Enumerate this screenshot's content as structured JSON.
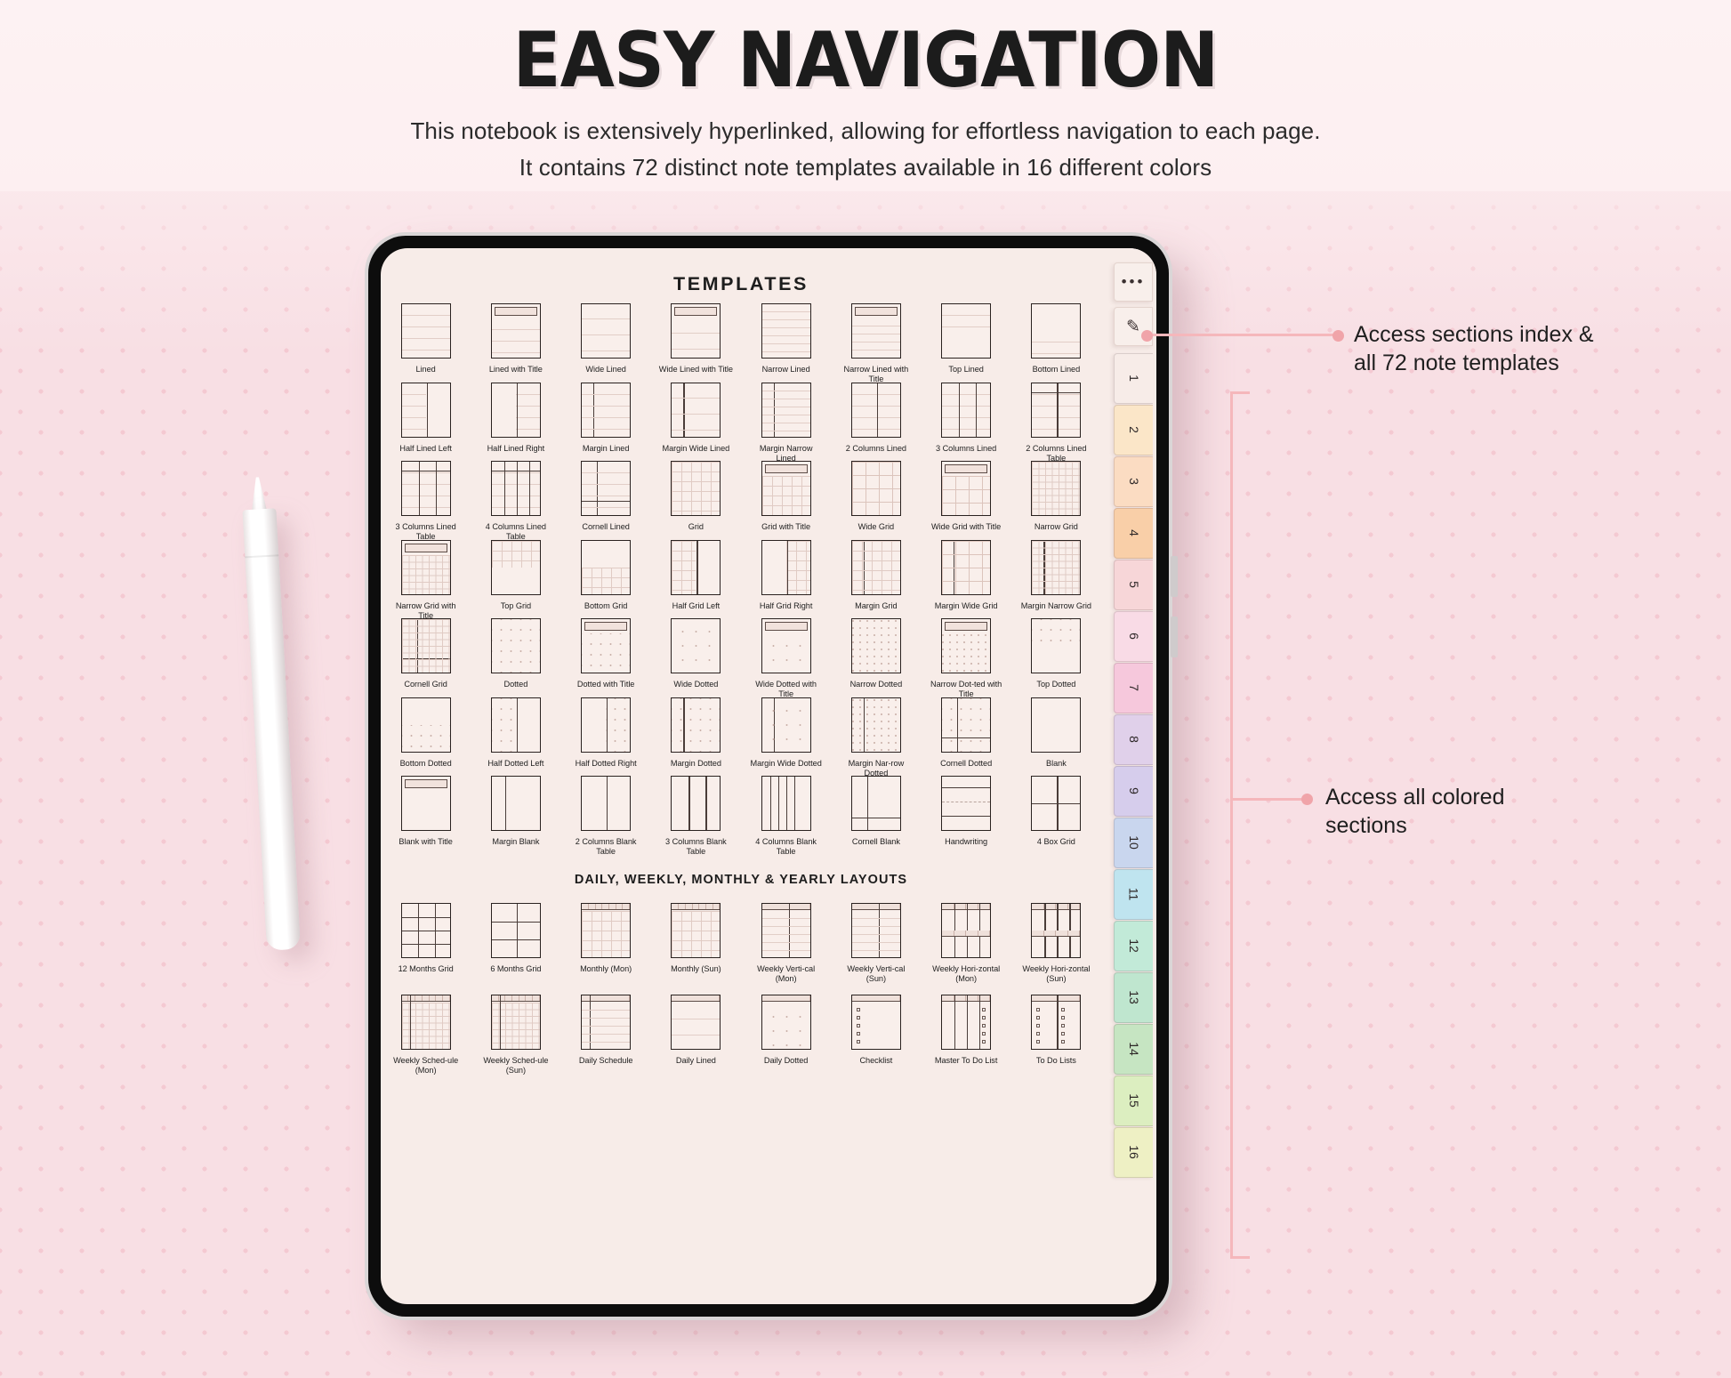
{
  "header": {
    "title": "EASY NAVIGATION",
    "subtitle_line1": "This notebook is extensively hyperlinked, allowing for effortless navigation to each page.",
    "subtitle_line2": "It contains 72 distinct note templates available in 16 different colors"
  },
  "screen": {
    "title": "TEMPLATES",
    "section_heading": "DAILY, WEEKLY, MONTHLY & YEARLY LAYOUTS"
  },
  "rail": {
    "menu_icon": "three-dots-icon",
    "menu_glyph": "•••",
    "pen_icon": "pencil-icon",
    "pen_glyph": "✎",
    "color_tabs": [
      {
        "number": "1",
        "color": "#f7ece8"
      },
      {
        "number": "2",
        "color": "#fbe6c8"
      },
      {
        "number": "3",
        "color": "#fbdcc2"
      },
      {
        "number": "4",
        "color": "#f9cfa8"
      },
      {
        "number": "5",
        "color": "#f7d6d8"
      },
      {
        "number": "6",
        "color": "#f9dbe6"
      },
      {
        "number": "7",
        "color": "#f6c8dc"
      },
      {
        "number": "8",
        "color": "#e0d0ea"
      },
      {
        "number": "9",
        "color": "#d6cdec"
      },
      {
        "number": "10",
        "color": "#c9d6ee"
      },
      {
        "number": "11",
        "color": "#bfe4ef"
      },
      {
        "number": "12",
        "color": "#c2ead8"
      },
      {
        "number": "13",
        "color": "#bfe6cf"
      },
      {
        "number": "14",
        "color": "#c6e5c2"
      },
      {
        "number": "15",
        "color": "#dceec0"
      },
      {
        "number": "16",
        "color": "#eef0c4"
      }
    ]
  },
  "annotations": [
    {
      "id": "index-annotation",
      "line1": "Access sections index &",
      "line2": "all 72 note templates"
    },
    {
      "id": "colors-annotation",
      "line1": "Access all colored",
      "line2": "sections"
    }
  ],
  "templates": {
    "rows": [
      [
        {
          "label": "Lined",
          "kind": "lined"
        },
        {
          "label": "Lined with Title",
          "kind": "lined-title"
        },
        {
          "label": "Wide Lined",
          "kind": "wide-lined"
        },
        {
          "label": "Wide Lined with Title",
          "kind": "wide-lined-title"
        },
        {
          "label": "Narrow Lined",
          "kind": "narrow-lined"
        },
        {
          "label": "Narrow Lined with Title",
          "kind": "narrow-lined-title"
        },
        {
          "label": "Top Lined",
          "kind": "top-lined"
        },
        {
          "label": "Bottom Lined",
          "kind": "bottom-lined"
        }
      ],
      [
        {
          "label": "Half Lined Left",
          "kind": "half-lined-left"
        },
        {
          "label": "Half Lined Right",
          "kind": "half-lined-right"
        },
        {
          "label": "Margin Lined",
          "kind": "margin-lined"
        },
        {
          "label": "Margin Wide Lined",
          "kind": "margin-wide-lined"
        },
        {
          "label": "Margin Narrow Lined",
          "kind": "margin-narrow-lined"
        },
        {
          "label": "2 Columns Lined",
          "kind": "2col-lined"
        },
        {
          "label": "3 Columns Lined",
          "kind": "3col-lined"
        },
        {
          "label": "2 Columns Lined Table",
          "kind": "2col-lined-table"
        }
      ],
      [
        {
          "label": "3 Columns Lined Table",
          "kind": "3col-lined-table"
        },
        {
          "label": "4 Columns Lined Table",
          "kind": "4col-lined-table"
        },
        {
          "label": "Cornell Lined",
          "kind": "cornell-lined"
        },
        {
          "label": "Grid",
          "kind": "grid"
        },
        {
          "label": "Grid with Title",
          "kind": "grid-title"
        },
        {
          "label": "Wide Grid",
          "kind": "wide-grid"
        },
        {
          "label": "Wide Grid with Title",
          "kind": "wide-grid-title"
        },
        {
          "label": "Narrow Grid",
          "kind": "narrow-grid"
        }
      ],
      [
        {
          "label": "Narrow Grid with Title",
          "kind": "narrow-grid-title"
        },
        {
          "label": "Top Grid",
          "kind": "top-grid"
        },
        {
          "label": "Bottom Grid",
          "kind": "bottom-grid"
        },
        {
          "label": "Half Grid Left",
          "kind": "half-grid-left"
        },
        {
          "label": "Half Grid Right",
          "kind": "half-grid-right"
        },
        {
          "label": "Margin Grid",
          "kind": "margin-grid"
        },
        {
          "label": "Margin Wide Grid",
          "kind": "margin-wide-grid"
        },
        {
          "label": "Margin Narrow Grid",
          "kind": "margin-narrow-grid"
        }
      ],
      [
        {
          "label": "Cornell Grid",
          "kind": "cornell-grid"
        },
        {
          "label": "Dotted",
          "kind": "dotted"
        },
        {
          "label": "Dotted with Title",
          "kind": "dotted-title"
        },
        {
          "label": "Wide Dotted",
          "kind": "wide-dotted"
        },
        {
          "label": "Wide Dotted with Title",
          "kind": "wide-dotted-title"
        },
        {
          "label": "Narrow Dotted",
          "kind": "narrow-dotted"
        },
        {
          "label": "Narrow Dot-ted with Title",
          "kind": "narrow-dotted-title"
        },
        {
          "label": "Top Dotted",
          "kind": "top-dotted"
        }
      ],
      [
        {
          "label": "Bottom Dotted",
          "kind": "bottom-dotted"
        },
        {
          "label": "Half Dotted Left",
          "kind": "half-dotted-left"
        },
        {
          "label": "Half Dotted Right",
          "kind": "half-dotted-right"
        },
        {
          "label": "Margin Dotted",
          "kind": "margin-dotted"
        },
        {
          "label": "Margin Wide Dotted",
          "kind": "margin-wide-dotted"
        },
        {
          "label": "Margin Nar-row Dotted",
          "kind": "margin-narrow-dotted"
        },
        {
          "label": "Cornell Dotted",
          "kind": "cornell-dotted"
        },
        {
          "label": "Blank",
          "kind": "blank"
        }
      ],
      [
        {
          "label": "Blank with Title",
          "kind": "blank-title"
        },
        {
          "label": "Margin Blank",
          "kind": "margin-blank"
        },
        {
          "label": "2 Columns Blank Table",
          "kind": "2col-blank-table"
        },
        {
          "label": "3 Columns Blank Table",
          "kind": "3col-blank-table"
        },
        {
          "label": "4 Columns Blank Table",
          "kind": "4col-blank-table"
        },
        {
          "label": "Cornell Blank",
          "kind": "cornell-blank"
        },
        {
          "label": "Handwriting",
          "kind": "handwriting"
        },
        {
          "label": "4 Box Grid",
          "kind": "4box-grid"
        }
      ]
    ],
    "layout_rows": [
      [
        {
          "label": "12 Months Grid",
          "kind": "12months"
        },
        {
          "label": "6 Months Grid",
          "kind": "6months"
        },
        {
          "label": "Monthly (Mon)",
          "kind": "monthly"
        },
        {
          "label": "Monthly (Sun)",
          "kind": "monthly"
        },
        {
          "label": "Weekly Verti-cal (Mon)",
          "kind": "weekly-vert"
        },
        {
          "label": "Weekly Verti-cal (Sun)",
          "kind": "weekly-vert"
        },
        {
          "label": "Weekly Hori-zontal (Mon)",
          "kind": "weekly-horiz"
        },
        {
          "label": "Weekly Hori-zontal (Sun)",
          "kind": "weekly-horiz"
        }
      ],
      [
        {
          "label": "Weekly Sched-ule (Mon)",
          "kind": "weekly-sched"
        },
        {
          "label": "Weekly Sched-ule (Sun)",
          "kind": "weekly-sched"
        },
        {
          "label": "Daily Schedule",
          "kind": "daily-sched"
        },
        {
          "label": "Daily Lined",
          "kind": "daily-lined"
        },
        {
          "label": "Daily Dotted",
          "kind": "daily-dotted"
        },
        {
          "label": "Checklist",
          "kind": "checklist"
        },
        {
          "label": "Master To Do List",
          "kind": "master-todo"
        },
        {
          "label": "To Do Lists",
          "kind": "todo-lists"
        }
      ]
    ]
  }
}
